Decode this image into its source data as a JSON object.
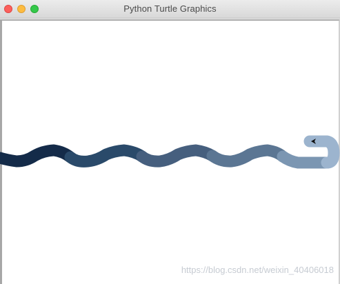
{
  "window": {
    "title": "Python Turtle Graphics"
  },
  "canvas": {
    "background": "#ffffff",
    "python_snake": {
      "segment_colors": [
        "#142b49",
        "#2a4a6a",
        "#465f7e",
        "#5b7693",
        "#7b96b2",
        "#9cb4ce"
      ],
      "turtle_cursor_icon": "arrow-head-pointing-left"
    }
  },
  "watermark": {
    "text": "https://blog.csdn.net/weixin_40406018"
  }
}
